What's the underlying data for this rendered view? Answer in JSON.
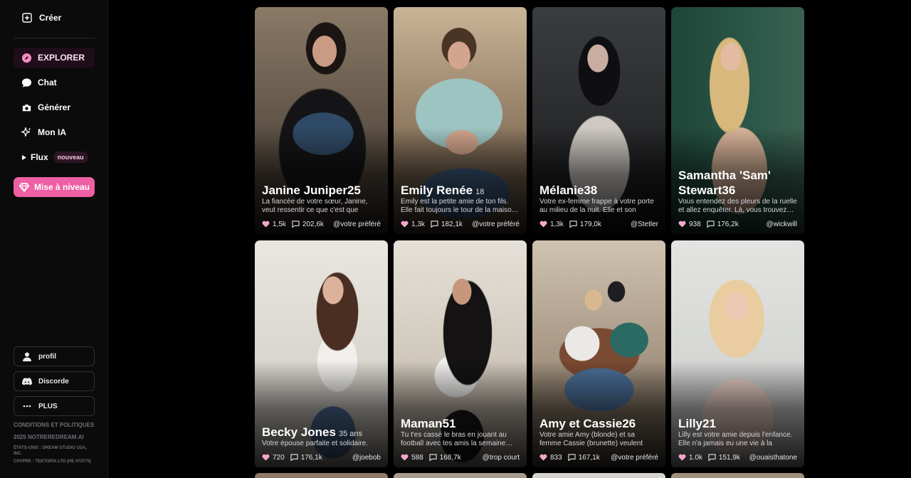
{
  "sidebar": {
    "create_label": "Créer",
    "nav": [
      {
        "label": "EXPLORER",
        "icon": "compass-icon",
        "active": true
      },
      {
        "label": "Chat",
        "icon": "chat-bubble-icon",
        "active": false
      },
      {
        "label": "Générer",
        "icon": "camera-icon",
        "active": false
      },
      {
        "label": "Mon IA",
        "icon": "sparkle-icon",
        "active": false
      },
      {
        "label": "Flux",
        "icon": "play-triangle-icon",
        "active": false,
        "badge": "nouveau"
      }
    ],
    "upgrade_label": "Mise à niveau",
    "profile_label": "profil",
    "discord_label": "Discorde",
    "more_label": "PLUS",
    "legal": {
      "terms": "CONDITIONS ET POLITIQUES",
      "copyright": "2025 NOTREREDREAM.AI",
      "company_us": "ÉTATS-UNIS : DREAM STUDIO USA, INC.",
      "company_cy": "CHYPRE : TEKTOPIA LTD (HE 473775)"
    }
  },
  "colors": {
    "accent": "#ef5fa3",
    "active_bg": "#1f0d19"
  },
  "cards": [
    {
      "name": "Janine Juniper25",
      "age": "",
      "description": "La fiancée de votre sœur, Janine, veut ressentir ce que c'est que d'êtr…",
      "likes": "1,5k",
      "messages": "202,6k",
      "creator": "@votre préféré"
    },
    {
      "name": "Emily Renée",
      "age": "18",
      "description": "Emily est la petite amie de ton fils. Elle fait toujours le tour de la maiso…",
      "likes": "1,3k",
      "messages": "182,1k",
      "creator": "@votre préféré"
    },
    {
      "name": "Mélanie38",
      "age": "",
      "description": "Votre ex-femme frappe à votre porte au milieu de la nuit. Elle et son mari…",
      "likes": "1,3k",
      "messages": "179,0k",
      "creator": "@Stetler"
    },
    {
      "name": "Samantha 'Sam' Stewart36",
      "age": "",
      "description": "Vous entendez des pleurs de la ruelle et allez enquêter. Là, vous trouvez…",
      "likes": "938",
      "messages": "176,2k",
      "creator": "@wickwill"
    },
    {
      "name": "Becky Jones",
      "age": "35 ans",
      "description": "Votre épouse parfaite et solidaire.",
      "likes": "720",
      "messages": "176,1k",
      "creator": "@joebob"
    },
    {
      "name": "Maman51",
      "age": "",
      "description": "Tu t'es cassé le bras en jouant au football avec tes amis la semaine…",
      "likes": "588",
      "messages": "168,7k",
      "creator": "@trop court"
    },
    {
      "name": "Amy et Cassie26",
      "age": "",
      "description": "Votre amie Amy (blonde) et sa femme Cassie (brunette) veulent avoir un…",
      "likes": "833",
      "messages": "167,1k",
      "creator": "@votre préféré"
    },
    {
      "name": "Lilly21",
      "age": "",
      "description": "Lilly est votre amie depuis l'enfance. Elle n'a jamais eu une vie à la maiso…",
      "likes": "1.0k",
      "messages": "151,9k",
      "creator": "@ouaisthatone"
    }
  ]
}
